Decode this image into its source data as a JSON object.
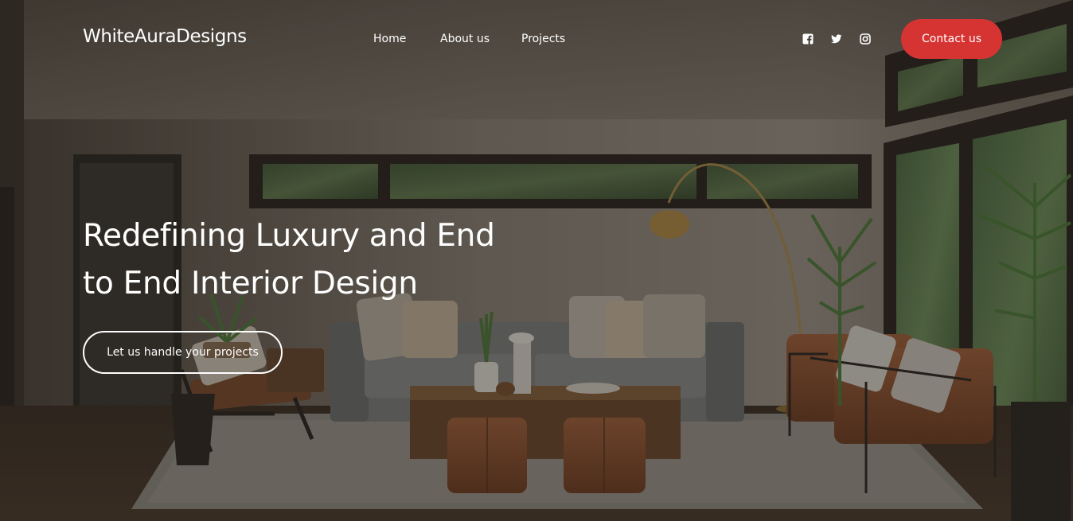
{
  "brand": {
    "name": "WhiteAuraDesigns"
  },
  "nav": {
    "items": [
      {
        "label": "Home"
      },
      {
        "label": "About us"
      },
      {
        "label": "Projects"
      }
    ]
  },
  "social": {
    "icons": [
      "facebook-icon",
      "twitter-icon",
      "instagram-icon"
    ]
  },
  "header": {
    "contact_label": "Contact us"
  },
  "hero": {
    "headline_line1": "Redefining Luxury and End",
    "headline_line2": "to End Interior Design",
    "cta_label": "Let us handle your projects"
  },
  "colors": {
    "accent": "#d63333",
    "text": "#ffffff"
  }
}
